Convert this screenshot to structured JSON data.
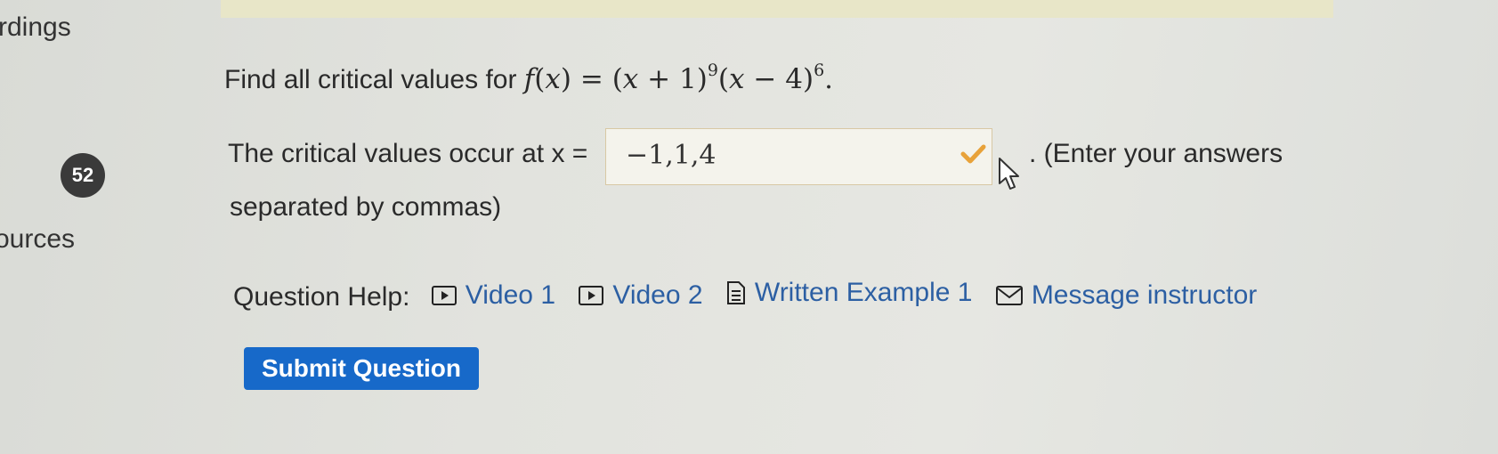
{
  "sidebar": {
    "records_label": "rdings",
    "resources_label": "ources"
  },
  "question": {
    "number": "52",
    "prompt_text": "Find all critical values for",
    "function": {
      "f": "f",
      "x": "x",
      "eq": "=",
      "open": "(",
      "close": ")",
      "plus": "+",
      "minus": "−",
      "one": "1",
      "four": "4",
      "exp1": "9",
      "exp2": "6",
      "period": "."
    }
  },
  "answer": {
    "prefix": "The critical values occur at x =",
    "value": "−1,1,4",
    "hint_tail": ". (Enter your answers",
    "hint_line2": "separated by commas)",
    "status": "correct",
    "status_color": "#e8a23a"
  },
  "help": {
    "label": "Question Help:",
    "links": [
      {
        "label": "Video 1",
        "icon": "video-icon"
      },
      {
        "label": "Video 2",
        "icon": "video-icon"
      },
      {
        "label": "Written Example 1",
        "icon": "document-icon"
      },
      {
        "label": "Message instructor",
        "icon": "mail-icon"
      }
    ]
  },
  "submit": {
    "label": "Submit Question",
    "color": "#1769c9"
  }
}
